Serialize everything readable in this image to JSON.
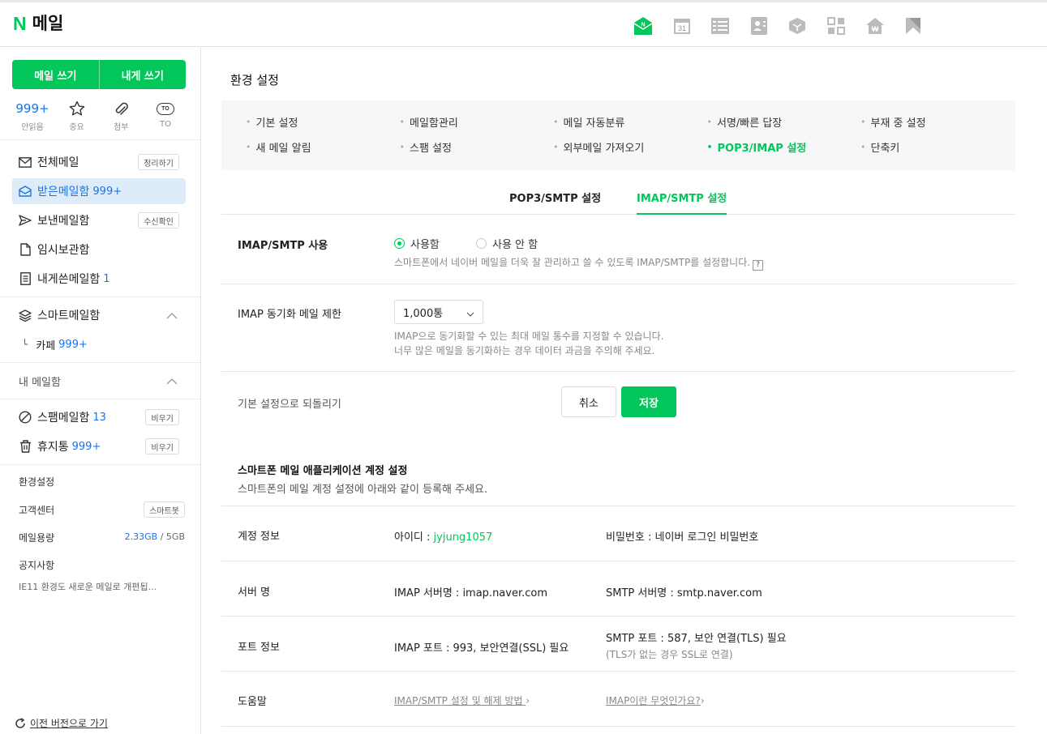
{
  "header": {
    "logo_mark": "N",
    "logo_text": "메일",
    "apps": [
      {
        "icon": "mail-app-icon",
        "active": true
      },
      {
        "icon": "calendar-app-icon",
        "calendar_day": "31"
      },
      {
        "icon": "list-app-icon"
      },
      {
        "icon": "contacts-app-icon"
      },
      {
        "icon": "box-app-icon"
      },
      {
        "icon": "grid-app-icon"
      },
      {
        "icon": "home-won-app-icon"
      },
      {
        "icon": "bookmark-app-icon"
      }
    ]
  },
  "sidebar": {
    "compose_label": "메일 쓰기",
    "self_compose_label": "내게 쓰기",
    "quick": {
      "unread_count": "999+",
      "unread_label": "안읽음",
      "important_label": "중요",
      "attach_label": "첨부",
      "to_badge": "TO",
      "to_label": "TO"
    },
    "all_mail": {
      "label": "전체메일",
      "button": "정리하기"
    },
    "inbox": {
      "label": "받은메일함",
      "count": "999+"
    },
    "sent": {
      "label": "보낸메일함",
      "button": "수신확인"
    },
    "drafts": {
      "label": "임시보관함"
    },
    "self_mail": {
      "label": "내게쓴메일함",
      "count": "1"
    },
    "smart_mailbox": {
      "label": "스마트메일함"
    },
    "cafe": {
      "prefix": "└",
      "label": "카페",
      "count": "999+"
    },
    "my_mailbox_title": "내 메일함",
    "spam": {
      "label": "스팸메일함",
      "count": "13",
      "button": "비우기"
    },
    "trash": {
      "label": "휴지통",
      "count": "999+",
      "button": "비우기"
    },
    "settings_label": "환경설정",
    "support_label": "고객센터",
    "support_button": "스마트봇",
    "quota_label": "메일용량",
    "quota_used": "2.33GB",
    "quota_sep": "/",
    "quota_total": "5GB",
    "notice_label": "공지사항",
    "notice_text": "IE11 환경도 새로운 메일로 개편됩...",
    "prev_version": "이전 버전으로 가기"
  },
  "main": {
    "title": "환경 설정",
    "menu_row1": [
      "기본 설정",
      "메일함관리",
      "메일 자동분류",
      "서명/빠른 답장",
      "부재 중 설정"
    ],
    "menu_row2": [
      "새 메일 알림",
      "스팸 설정",
      "외부메일 가져오기",
      "POP3/IMAP 설정",
      "단축키"
    ],
    "tabs": {
      "pop3": "POP3/SMTP 설정",
      "imap": "IMAP/SMTP 설정"
    },
    "imap_use": {
      "label": "IMAP/SMTP 사용",
      "option_on": "사용함",
      "option_off": "사용 안 함",
      "desc": "스마트폰에서 네이버 메일을 더욱 잘 관리하고 쓸 수 있도록 IMAP/SMTP를 설정합니다.",
      "help": "?"
    },
    "sync_limit": {
      "label": "IMAP 동기화 메일 제한",
      "value": "1,000통",
      "desc1": "IMAP으로 동기화할 수 있는 최대 메일 통수를 지정할 수 있습니다.",
      "desc2": "너무 많은 메일을 동기화하는 경우 데이터 과금을 주의해 주세요."
    },
    "reset_label": "기본 설정으로 되돌리기",
    "cancel_label": "취소",
    "save_label": "저장",
    "app_section": {
      "title": "스마트폰 메일 애플리케이션 계정 설정",
      "subtitle": "스마트폰의 메일 계정 설정에 아래와 같이 등록해 주세요."
    },
    "account": {
      "label": "계정 정보",
      "id_prefix": "아이디 : ",
      "id_value": "jyjung1057",
      "password": "비밀번호 : 네이버 로그인 비밀번호"
    },
    "server": {
      "label": "서버 명",
      "imap": "IMAP 서버명 : imap.naver.com",
      "smtp": "SMTP 서버명 : smtp.naver.com"
    },
    "port": {
      "label": "포트 정보",
      "imap": "IMAP 포트 : 993, 보안연결(SSL) 필요",
      "smtp": "SMTP 포트 : 587, 보안 연결(TLS) 필요",
      "smtp_note": "(TLS가 없는 경우 SSL로 연결)"
    },
    "help": {
      "label": "도움말",
      "link1": "IMAP/SMTP 설정 및 해제 방법",
      "link2": "IMAP이란 무엇인가요?"
    }
  },
  "colors": {
    "accent": "#03c75a",
    "link_blue": "#1a73e8",
    "active_bg": "#deecf9"
  }
}
